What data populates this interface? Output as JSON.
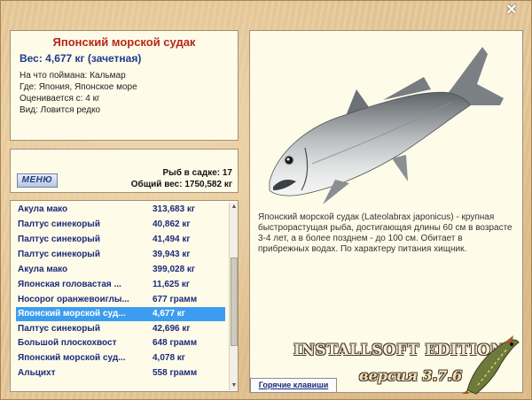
{
  "window": {
    "close_icon": "close-icon"
  },
  "fish_info": {
    "title": "Японский морской судак",
    "weight": "Вес: 4,677 кг (зачетная)",
    "caught_on": "На что поймана: Кальмар",
    "location": "Где: Япония, Японское море",
    "value": "Оценивается с: 4 кг",
    "rarity": "Вид: Ловится редко"
  },
  "stats": {
    "menu_label": "МЕНЮ",
    "fish_in_keepnet": "Рыб в садке: 17",
    "total_weight": "Общий вес: 1750,582 кг"
  },
  "catch_list": [
    {
      "name": "Акула мако",
      "weight": "313,683 кг"
    },
    {
      "name": "Палтус синекорый",
      "weight": "40,862 кг"
    },
    {
      "name": "Палтус синекорый",
      "weight": "41,494 кг"
    },
    {
      "name": "Палтус синекорый",
      "weight": "39,943 кг"
    },
    {
      "name": "Акула мако",
      "weight": "399,028 кг"
    },
    {
      "name": "Японская головастая ...",
      "weight": "11,625 кг"
    },
    {
      "name": "Носорог оранжевоиглы...",
      "weight": "677 грамм"
    },
    {
      "name": "Японский морской суд...",
      "weight": "4,677 кг",
      "selected": true
    },
    {
      "name": "Палтус синекорый",
      "weight": "42,696 кг"
    },
    {
      "name": "Большой плоскохвост",
      "weight": "648 грамм"
    },
    {
      "name": "Японский морской суд...",
      "weight": "4,078 кг"
    },
    {
      "name": "Альцихт",
      "weight": "558 грамм"
    }
  ],
  "photo": {
    "description": "Японский морской судак (Lateolabrax japonicus) - крупная быстрорастущая рыба, достигающая длины 60 см в возрасте 3-4 лет, а в более позднем - до 100 см. Обитает в прибрежных водах. По характеру питания хищник.",
    "hotkeys_label": "Горячие клавиши"
  },
  "branding": {
    "edition": "INSTALLSOFT EDITION",
    "version": "версия 3.7.6"
  },
  "colors": {
    "title_red": "#b5261a",
    "list_blue": "#1a2b7a",
    "selection": "#3c9df0",
    "panel_bg": "#fffbe9",
    "wood_bg": "#e7c99a"
  }
}
